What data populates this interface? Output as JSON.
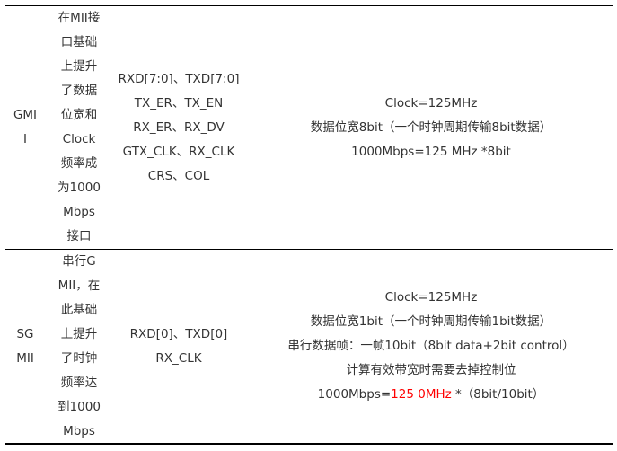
{
  "rows": [
    {
      "name_lines": [
        "GMI",
        "I"
      ],
      "description_lines": [
        "在MII接",
        "口基础",
        "上提升",
        "了数据",
        "位宽和",
        "Clock",
        "频率成",
        "为1000",
        "Mbps",
        "接口"
      ],
      "signal_lines": [
        "RXD[7:0]、TXD[7:0]",
        "TX_ER、TX_EN",
        "RX_ER、RX_DV",
        "GTX_CLK、RX_CLK",
        "CRS、COL"
      ],
      "clock_lines": [
        "Clock=125MHz",
        "数据位宽8bit（一个时钟周期传输8bit数据）",
        "1000Mbps=125 MHz *8bit"
      ]
    },
    {
      "name_lines": [
        "SG",
        "MII"
      ],
      "description_lines": [
        "串行G",
        "MII，在",
        "此基础",
        "上提升",
        "了时钟",
        "频率达",
        "到1000",
        "Mbps"
      ],
      "signal_lines": [
        "RXD[0]、TXD[0]",
        "RX_CLK"
      ],
      "clock_lines": [
        "Clock=125MHz",
        "数据位宽1bit（一个时钟周期传输1bit数据）",
        "串行数据帧：一帧10bit（8bit data+2bit control）",
        "计算有效带宽时需要去掉控制位"
      ],
      "clock_last_line": {
        "prefix": "1000Mbps=",
        "highlight": "125 0MHz",
        "suffix": " *（8bit/10bit）"
      }
    }
  ],
  "colors": {
    "text": "#333333",
    "highlight": "#ff0000",
    "rule": "#000000"
  }
}
